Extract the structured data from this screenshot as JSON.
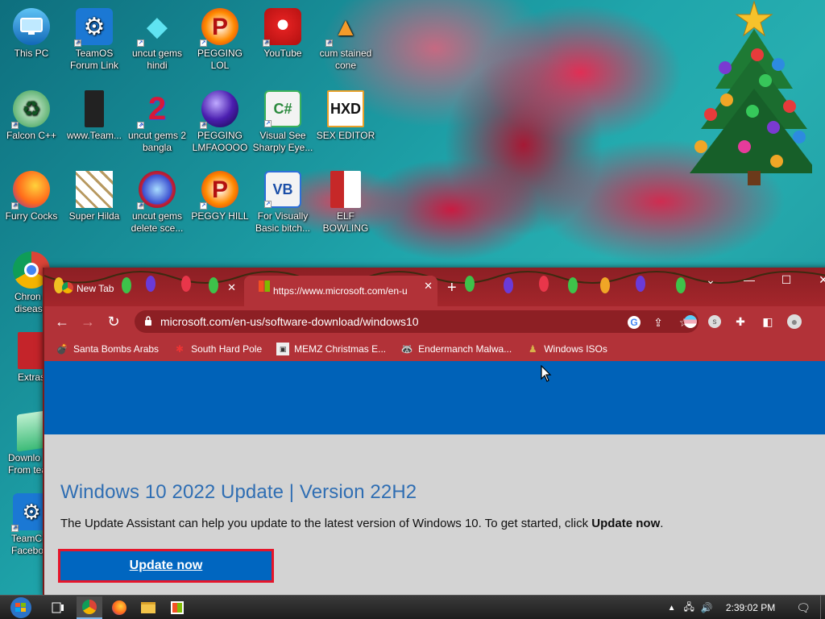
{
  "desktop": {
    "icons": [
      {
        "label": "This PC"
      },
      {
        "label": "TeamOS Forum Link"
      },
      {
        "label": "uncut gems hindi"
      },
      {
        "label": "PEGGING LOL"
      },
      {
        "label": "YouTube"
      },
      {
        "label": "cum stained cone"
      },
      {
        "label": "Falcon C++"
      },
      {
        "label": "www.Team..."
      },
      {
        "label": "uncut gems 2 bangla"
      },
      {
        "label": "PEGGING LMFAOOOO"
      },
      {
        "label": "Visual See Sharply Eye..."
      },
      {
        "label": "SEX EDITOR"
      },
      {
        "label": "Furry Cocks"
      },
      {
        "label": "Super Hilda"
      },
      {
        "label": "uncut gems delete sce..."
      },
      {
        "label": "PEGGY HILL"
      },
      {
        "label": "For Visually Basic bitch..."
      },
      {
        "label": "ELF BOWLING"
      },
      {
        "label": "Chron diseas"
      },
      {
        "label": "Extras"
      },
      {
        "label": "Downlo From tea"
      },
      {
        "label": "TeamC Facebo"
      }
    ]
  },
  "browser": {
    "tabs": [
      {
        "title": "New Tab"
      },
      {
        "title": "https://www.microsoft.com/en-u"
      }
    ],
    "address": "microsoft.com/en-us/software-download/windows10",
    "bookmarks": [
      {
        "label": "Santa Bombs Arabs"
      },
      {
        "label": "South Hard Pole"
      },
      {
        "label": "MEMZ Christmas E..."
      },
      {
        "label": "Endermanch Malwa..."
      },
      {
        "label": "Windows ISOs"
      }
    ],
    "page": {
      "title": "Windows 10 2022 Update | Version 22H2",
      "desc_prefix": "The Update Assistant can help you update to the latest version of Windows 10. To get started, click ",
      "desc_bold": "Update now",
      "desc_suffix": ".",
      "button": "Update now"
    }
  },
  "taskbar": {
    "time": "2:39:02 PM"
  },
  "colors": {
    "accent": "#0062b8",
    "browser_frame": "#b23238",
    "button_border": "#e5152a",
    "title": "#2f6eb3"
  }
}
